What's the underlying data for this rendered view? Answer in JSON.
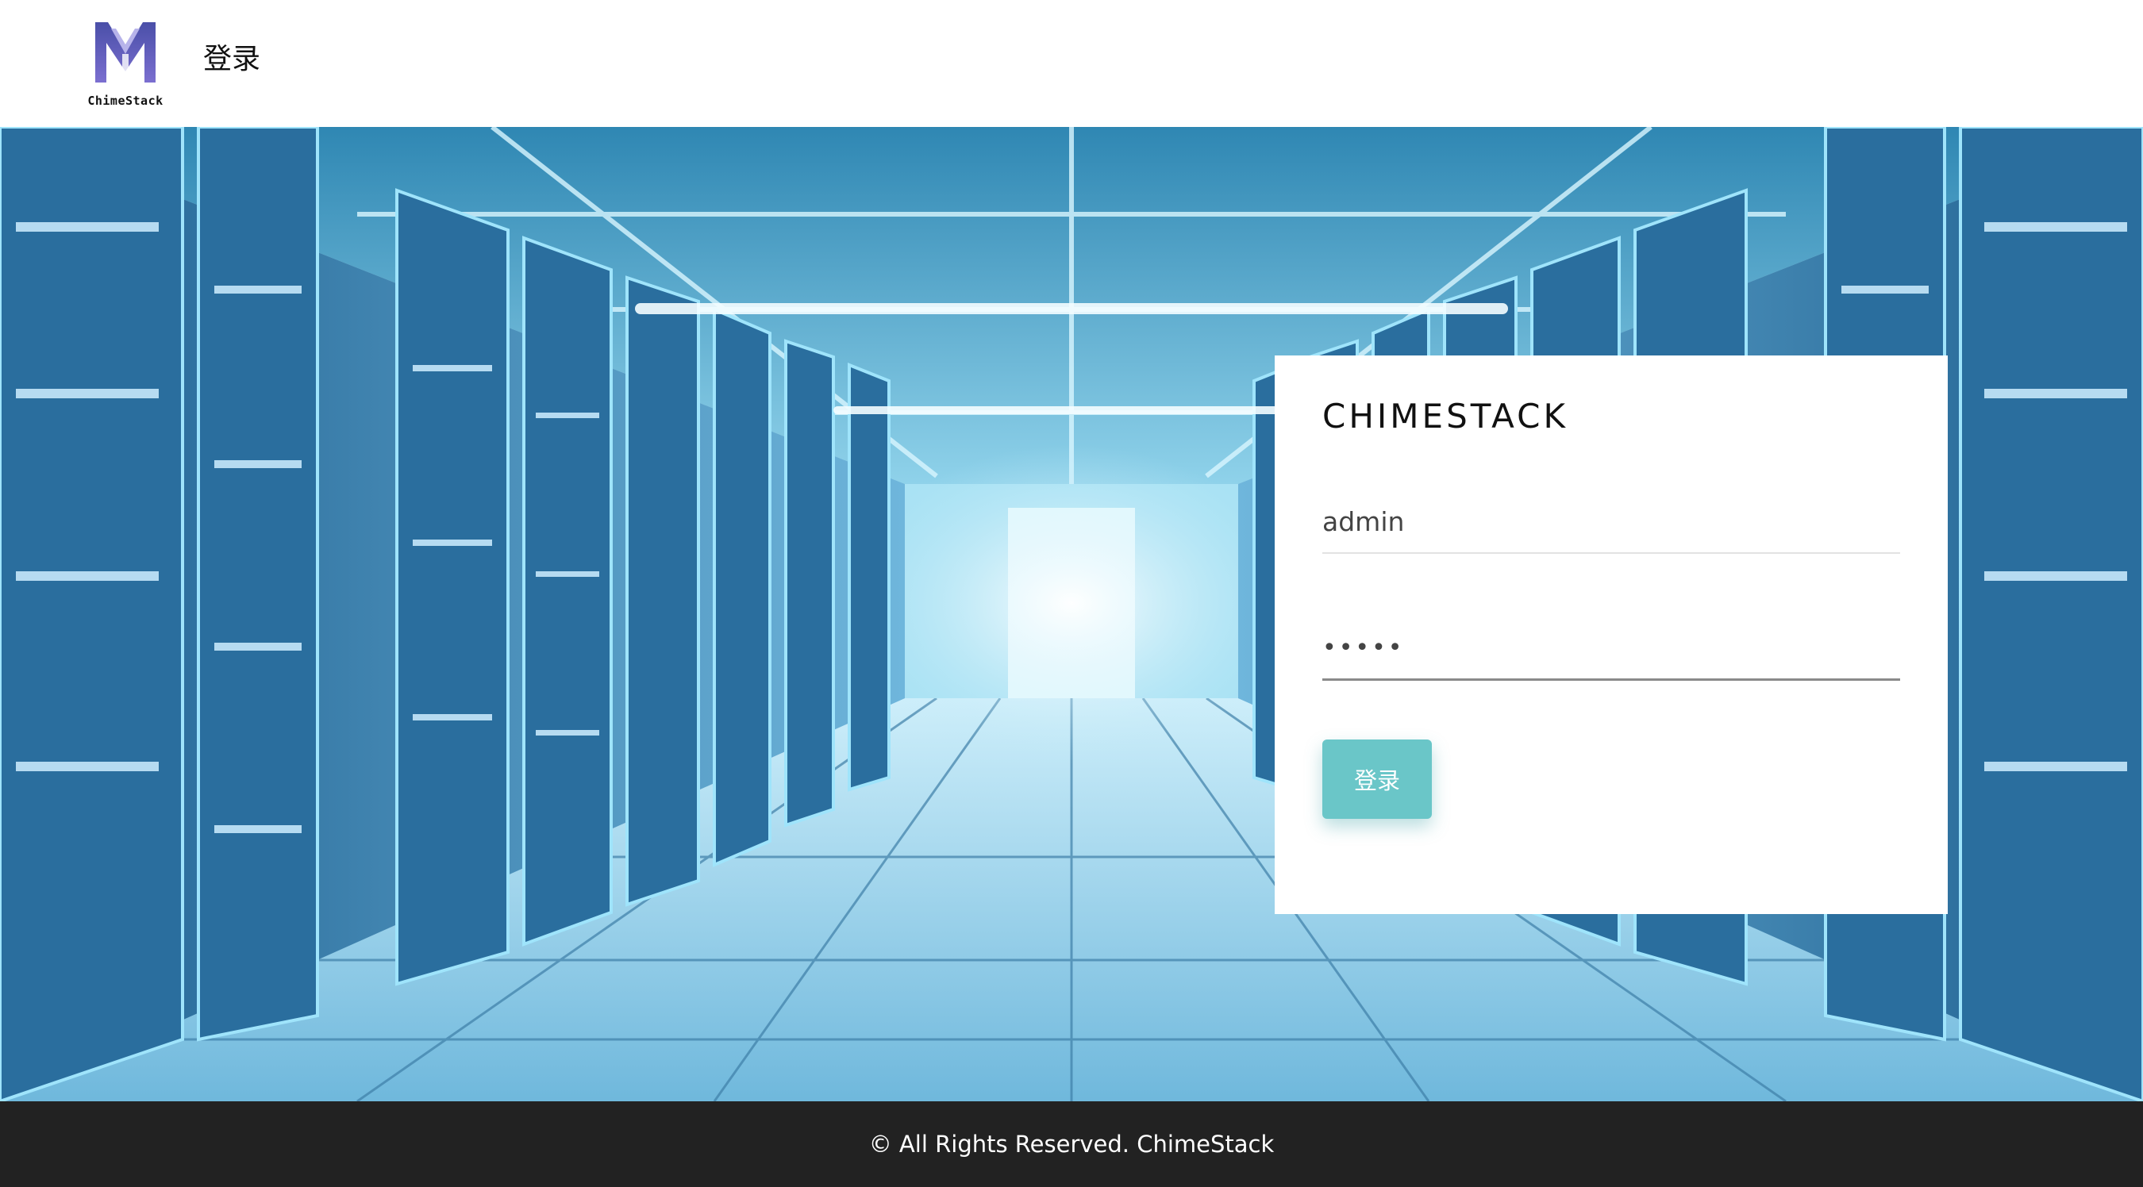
{
  "header": {
    "logo_text": "ChimeStack",
    "title": "登录"
  },
  "login": {
    "title": "CHIMESTACK",
    "username_value": "admin",
    "password_value": "•••••",
    "submit_label": "登录"
  },
  "footer": {
    "text": "© All Rights Reserved. ChimeStack"
  },
  "colors": {
    "accent": "#6ac6c8",
    "footer_bg": "#222222",
    "hero_tint": "#9fd4ea"
  }
}
